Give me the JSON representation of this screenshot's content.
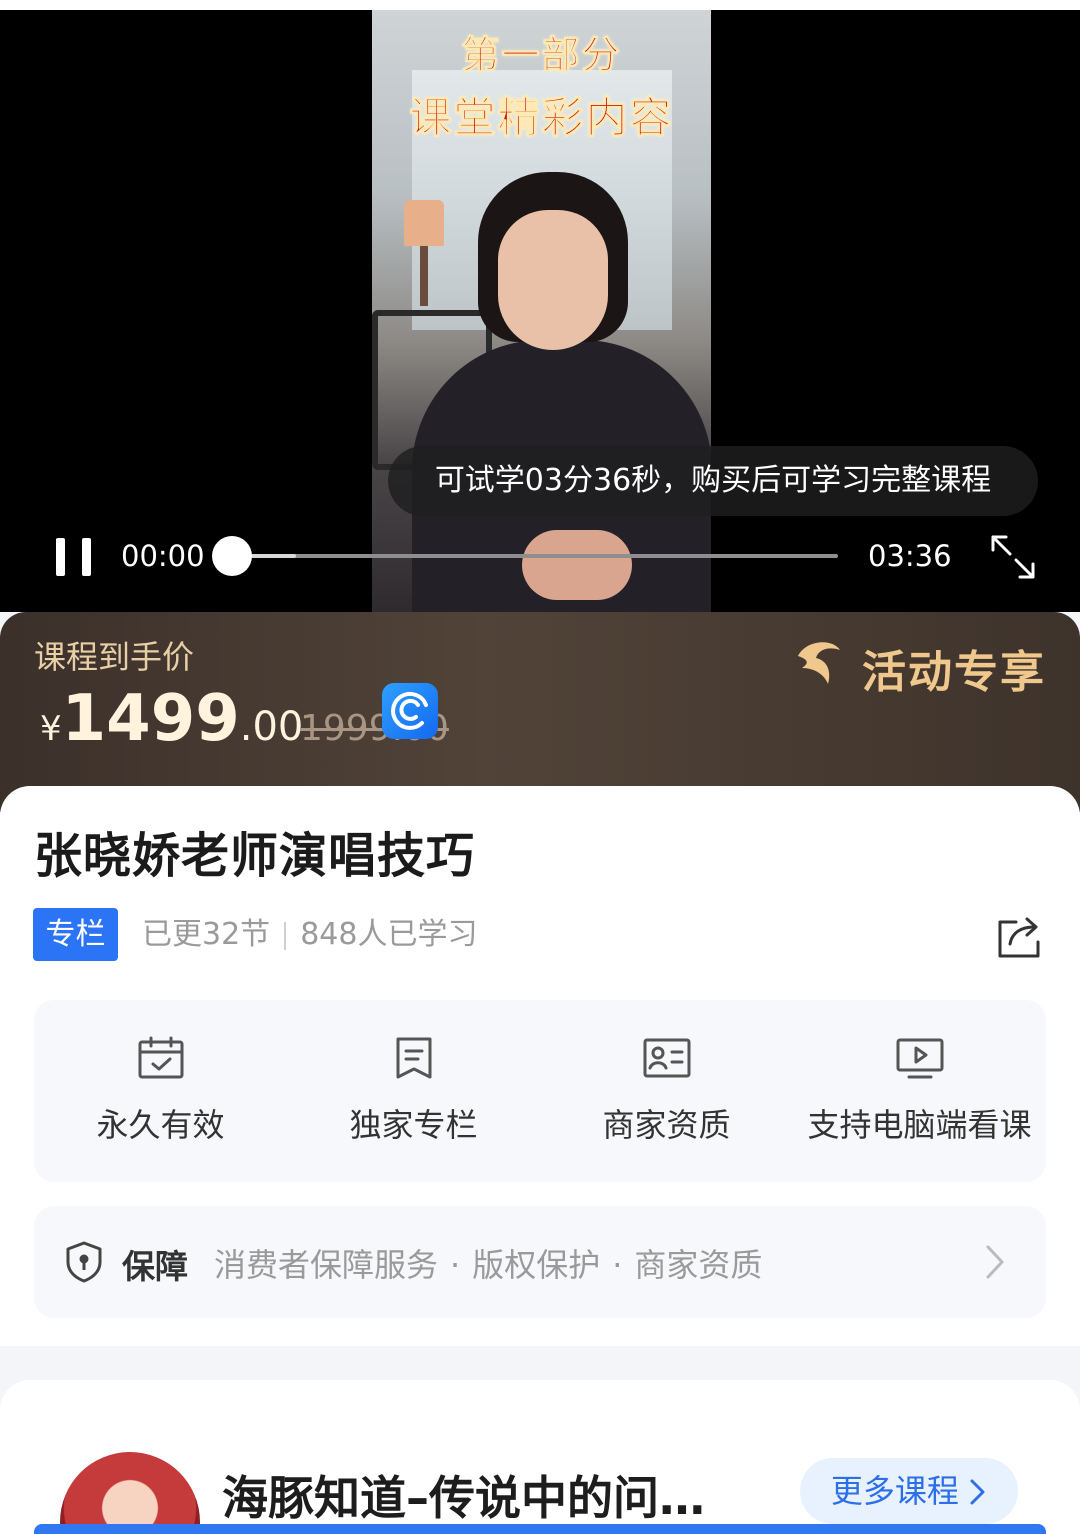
{
  "player": {
    "overlay_title_line1": "第一部分",
    "overlay_title_line2": "课堂精彩内容",
    "trial_notice": "可试学03分36秒，购买后可学习完整课程",
    "current_time": "00:00",
    "total_time": "03:36",
    "progress_fraction": 0.0,
    "state": "playing"
  },
  "price": {
    "label": "课程到手价",
    "currency": "¥",
    "integer": "1499",
    "decimal": ".00",
    "original": "1999.00",
    "promo_text": "活动专享"
  },
  "course": {
    "title": "张晓娇老师演唱技巧",
    "tag": "专栏",
    "updates": "已更32节",
    "learners": "848人已学习"
  },
  "features": [
    {
      "label": "永久有效",
      "icon": "calendar-check-icon"
    },
    {
      "label": "独家专栏",
      "icon": "document-icon"
    },
    {
      "label": "商家资质",
      "icon": "id-card-icon"
    },
    {
      "label": "支持电脑端看课",
      "icon": "monitor-play-icon"
    }
  ],
  "guarantee": {
    "title": "保障",
    "items": [
      "消费者保障服务",
      "版权保护",
      "商家资质"
    ],
    "separator": "·"
  },
  "shop": {
    "name": "海豚知道–传说中的问…",
    "more_label": "更多课程"
  },
  "colors": {
    "accent_blue": "#2c74f6",
    "price_gold": "#e9cfa6",
    "banner_brown": "#4a3d33"
  }
}
